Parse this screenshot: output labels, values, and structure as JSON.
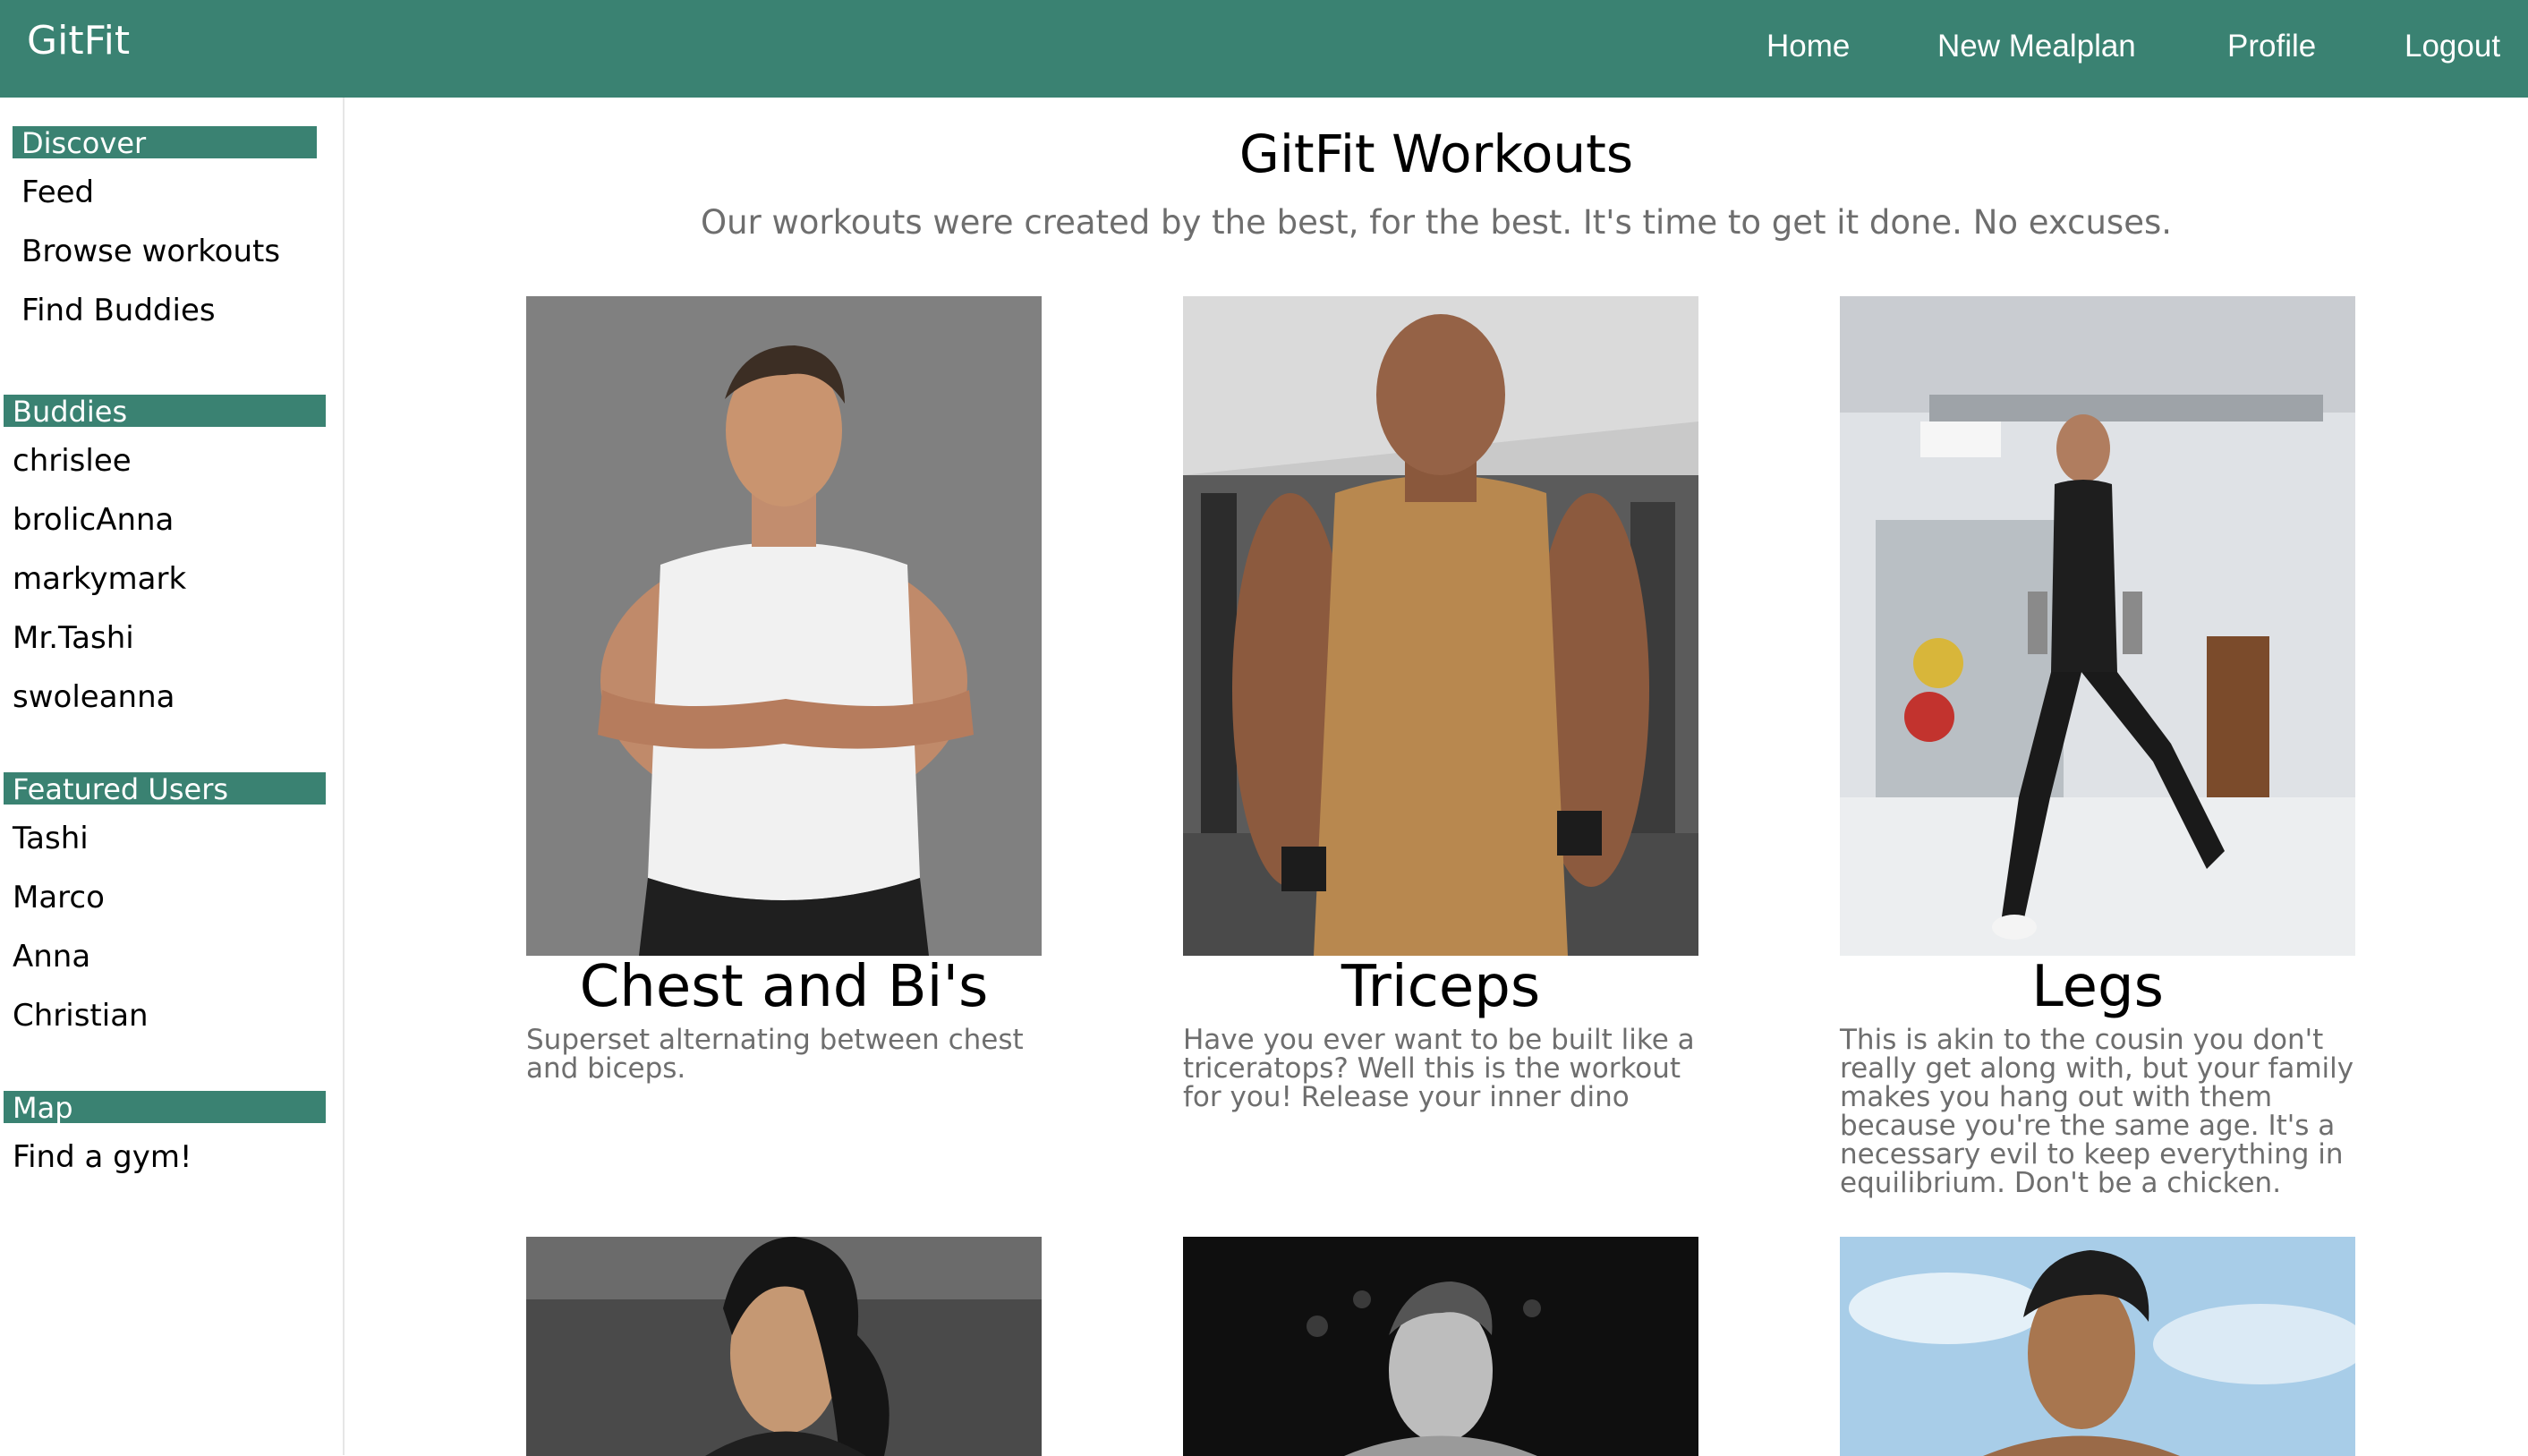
{
  "navbar": {
    "brand": "GitFit",
    "links": [
      "Home",
      "New Mealplan",
      "Profile",
      "Logout"
    ],
    "color": "#3a8272"
  },
  "sidebar": {
    "sections": [
      {
        "heading": "Discover",
        "items": [
          "Feed",
          "Browse workouts",
          "Find Buddies"
        ]
      },
      {
        "heading": "Buddies",
        "items": [
          "chrislee",
          "brolicAnna",
          "markymark",
          "Mr.Tashi",
          "swoleanna"
        ]
      },
      {
        "heading": "Featured Users",
        "items": [
          "Tashi",
          "Marco",
          "Anna",
          "Christian"
        ]
      },
      {
        "heading": "Map",
        "items": [
          "Find a gym!"
        ]
      }
    ]
  },
  "main": {
    "title": "GitFit Workouts",
    "subtitle": "Our workouts were created by the best, for the best. It's time to get it done. No excuses.",
    "workouts": [
      {
        "title": "Chest and Bi's",
        "description": "Superset alternating between chest and biceps.",
        "image": "muscular-man-white-tank-photo"
      },
      {
        "title": "Triceps",
        "description": "Have you ever want to be built like a triceratops? Well this is the workout for you! Release your inner dino",
        "image": "man-gym-tank-top-photo"
      },
      {
        "title": "Legs",
        "description": "This is akin to the cousin you don't really get along with, but your family makes you hang out with them because you're the same age. It's a necessary evil to keep everything in equilibrium. Don't be a chicken.",
        "image": "woman-lunge-dumbbells-photo"
      },
      {
        "title": "",
        "description": "",
        "image": "woman-gym-photo"
      },
      {
        "title": "",
        "description": "",
        "image": "bodybuilder-black-white-photo"
      },
      {
        "title": "",
        "description": "",
        "image": "man-beach-sky-photo"
      }
    ]
  }
}
